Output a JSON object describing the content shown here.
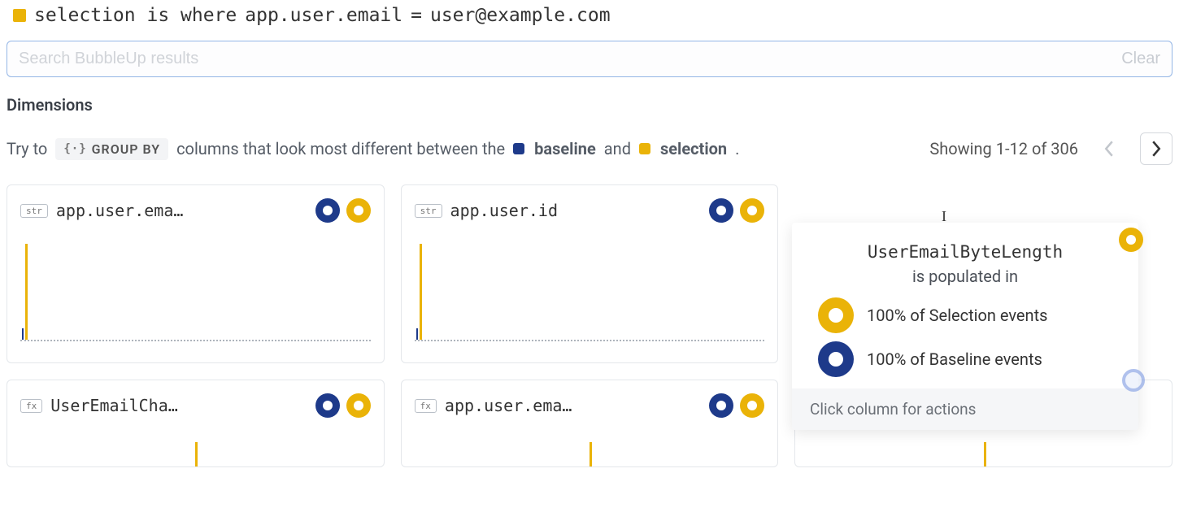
{
  "selection_clause": {
    "prefix": "selection is where",
    "field": "app.user.email",
    "op": "=",
    "value": "user@example.com"
  },
  "search": {
    "placeholder": "Search BubbleUp results",
    "clear_label": "Clear"
  },
  "dimensions": {
    "title": "Dimensions",
    "hint_lead": "Try to",
    "group_by_label": "GROUP BY",
    "hint_mid": "columns that look most different between the",
    "baseline_word": "baseline",
    "hint_and": "and",
    "selection_word": "selection",
    "hint_end": ".",
    "showing": "Showing 1-12 of 306"
  },
  "cards": [
    {
      "type": "str",
      "title": "app.user.ema…"
    },
    {
      "type": "str",
      "title": "app.user.id"
    },
    {
      "type": "",
      "title": ""
    },
    {
      "type": "fx",
      "title": "UserEmailCha…"
    },
    {
      "type": "fx",
      "title": "app.user.ema…"
    },
    {
      "type": "",
      "title": ""
    }
  ],
  "tooltip": {
    "title": "UserEmailByteLength",
    "sub": "is populated in",
    "selection_line": "100% of Selection events",
    "baseline_line": "100% of Baseline events",
    "footer": "Click column for actions"
  },
  "colors": {
    "baseline": "#1e3a8a",
    "selection": "#eab308"
  },
  "chart_data": [
    {
      "type": "bar",
      "title": "app.user.email",
      "series": [
        {
          "name": "selection",
          "values": [
            100
          ]
        },
        {
          "name": "baseline",
          "values": [
            5
          ]
        }
      ],
      "ylim": [
        0,
        100
      ]
    },
    {
      "type": "bar",
      "title": "app.user.id",
      "series": [
        {
          "name": "selection",
          "values": [
            100
          ]
        },
        {
          "name": "baseline",
          "values": [
            5
          ]
        }
      ],
      "ylim": [
        0,
        100
      ]
    }
  ]
}
